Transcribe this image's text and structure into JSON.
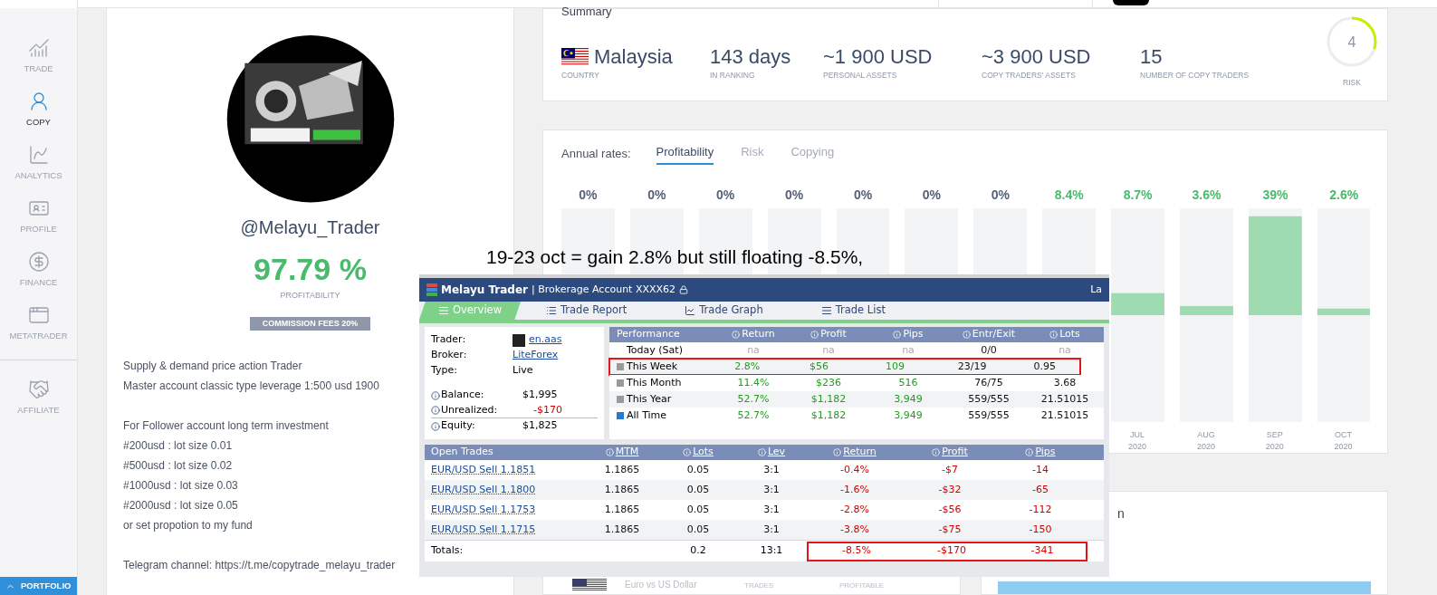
{
  "sidebar": {
    "items": [
      {
        "label": "TRADE",
        "selected": false
      },
      {
        "label": "COPY",
        "selected": true
      },
      {
        "label": "ANALYTICS",
        "selected": false
      },
      {
        "label": "PROFILE",
        "selected": false
      },
      {
        "label": "FINANCE",
        "selected": false
      },
      {
        "label": "METATRADER",
        "selected": false
      },
      {
        "label": "AFFILIATE",
        "selected": false
      }
    ],
    "portfolio_button": "PORTFOLIO"
  },
  "profile": {
    "username": "@Melayu_Trader",
    "profitability": "97.79 %",
    "profitability_label": "PROFITABILITY",
    "commission": "COMMISSION FEES 20%",
    "description": [
      [
        "Supply & demand price action Trader",
        "Master account classic type leverage 1:500 usd 1900"
      ],
      [
        "For Follower account long term investment",
        "#200usd : lot size 0.01",
        "#500usd : lot size 0.02",
        "#1000usd : lot size 0.03",
        "#2000usd : lot size 0.05",
        "or set propotion to my fund"
      ],
      [
        "Telegram channel: https://t.me/copytrade_melayu_trader"
      ]
    ]
  },
  "summary": {
    "title": "Summary",
    "stats": [
      {
        "kind": "country",
        "value": "Malaysia",
        "label": "COUNTRY"
      },
      {
        "kind": "plain",
        "value": "143 days",
        "label": "IN RANKING"
      },
      {
        "kind": "plain",
        "value": "~1 900 USD",
        "label": "PERSONAL ASSETS"
      },
      {
        "kind": "plain",
        "value": "~3 900 USD",
        "label": "COPY TRADERS' ASSETS"
      },
      {
        "kind": "plain",
        "value": "15",
        "label": "NUMBER OF COPY TRADERS"
      }
    ],
    "risk": {
      "value": "4",
      "label": "RISK",
      "level": 0.3
    }
  },
  "annual_rates": {
    "label": "Annual rates:",
    "tabs": [
      {
        "label": "Profitability",
        "selected": true
      },
      {
        "label": "Risk",
        "selected": false
      },
      {
        "label": "Copying",
        "selected": false
      }
    ],
    "chart_data": {
      "type": "bar",
      "categories": [
        null,
        null,
        null,
        null,
        null,
        null,
        null,
        null,
        "JUL 2020",
        "AUG 2020",
        "SEP 2020",
        "OCT 2020"
      ],
      "values": [
        0,
        0,
        0,
        0,
        0,
        0,
        0,
        null,
        8.7,
        3.6,
        39,
        2.6
      ],
      "value_labels": [
        "0%",
        "0%",
        "0%",
        "0%",
        "0%",
        "0%",
        "0%",
        "8.4%",
        "8.7%",
        "3.6%",
        "39%",
        "2.6%"
      ]
    }
  },
  "annotation": "19-23 oct = gain 2.8% but still floating -8.5%,",
  "overlay": {
    "title": "Melayu Trader",
    "subtitle": "| Brokerage Account XXXX62",
    "title_right": "La",
    "tabs": [
      {
        "label": "Overview",
        "selected": true
      },
      {
        "label": "Trade Report",
        "selected": false
      },
      {
        "label": "Trade Graph",
        "selected": false
      },
      {
        "label": "Trade List",
        "selected": false
      }
    ],
    "info": [
      {
        "label": "Trader:",
        "value": "en.aas",
        "kind": "avatar-link"
      },
      {
        "label": "Broker:",
        "value": "LiteForex",
        "kind": "link"
      },
      {
        "label": "Type:",
        "value": "Live",
        "kind": "text"
      },
      {
        "label": "Balance:",
        "value": "$1,995",
        "kind": "money"
      },
      {
        "label": "Unrealized:",
        "value": "-$170",
        "kind": "negative"
      },
      {
        "label": "Equity:",
        "value": "$1,825",
        "kind": "money"
      }
    ],
    "performance": {
      "columns": [
        "Performance",
        "Return",
        "Profit",
        "Pips",
        "Entr/Exit",
        "Lots"
      ],
      "rows": [
        {
          "has_data": false,
          "highlighted": false,
          "cells": [
            "Today (Sat)",
            "na",
            "na",
            "na",
            "0/0",
            "na"
          ]
        },
        {
          "color": "#9a9a9a",
          "has_data": true,
          "highlighted": true,
          "cells": [
            "This Week",
            "2.8%",
            "$56",
            "109",
            "23/19",
            "0.95"
          ]
        },
        {
          "color": "#9a9a9a",
          "has_data": true,
          "highlighted": false,
          "cells": [
            "This Month",
            "11.4%",
            "$236",
            "516",
            "76/75",
            "3.68"
          ]
        },
        {
          "color": "#9a9a9a",
          "has_data": true,
          "highlighted": false,
          "cells": [
            "This Year",
            "52.7%",
            "$1,182",
            "3,949",
            "559/555",
            "21.51015"
          ]
        },
        {
          "color": "#2a78d0",
          "has_data": true,
          "highlighted": false,
          "cells": [
            "All Time",
            "52.7%",
            "$1,182",
            "3,949",
            "559/555",
            "21.51015"
          ]
        }
      ]
    },
    "open_trades": {
      "columns": [
        "Open Trades",
        "MTM",
        "Lots",
        "Lev",
        "Return",
        "Profit",
        "Pips"
      ],
      "rows": [
        {
          "cells": [
            "EUR/USD Sell 1.1851",
            "1.1865",
            "0.05",
            "3:1",
            "-0.4%",
            "-$7",
            "-14"
          ]
        },
        {
          "cells": [
            "EUR/USD Sell 1.1800",
            "1.1865",
            "0.05",
            "3:1",
            "-1.6%",
            "-$32",
            "-65"
          ]
        },
        {
          "cells": [
            "EUR/USD Sell 1.1753",
            "1.1865",
            "0.05",
            "3:1",
            "-2.8%",
            "-$56",
            "-112"
          ]
        },
        {
          "cells": [
            "EUR/USD Sell 1.1715",
            "1.1865",
            "0.05",
            "3:1",
            "-3.8%",
            "-$75",
            "-150"
          ]
        }
      ],
      "totals": {
        "highlighted": true,
        "cells": [
          "Totals:",
          "",
          "0.2",
          "13:1",
          "-8.5%",
          "-$170",
          "-341"
        ]
      }
    }
  },
  "instrument_row": {
    "name": "Euro vs US Dollar",
    "column_1": "TRADES",
    "column_2": "PROFITABLE"
  },
  "right_card": {
    "title": "n"
  }
}
